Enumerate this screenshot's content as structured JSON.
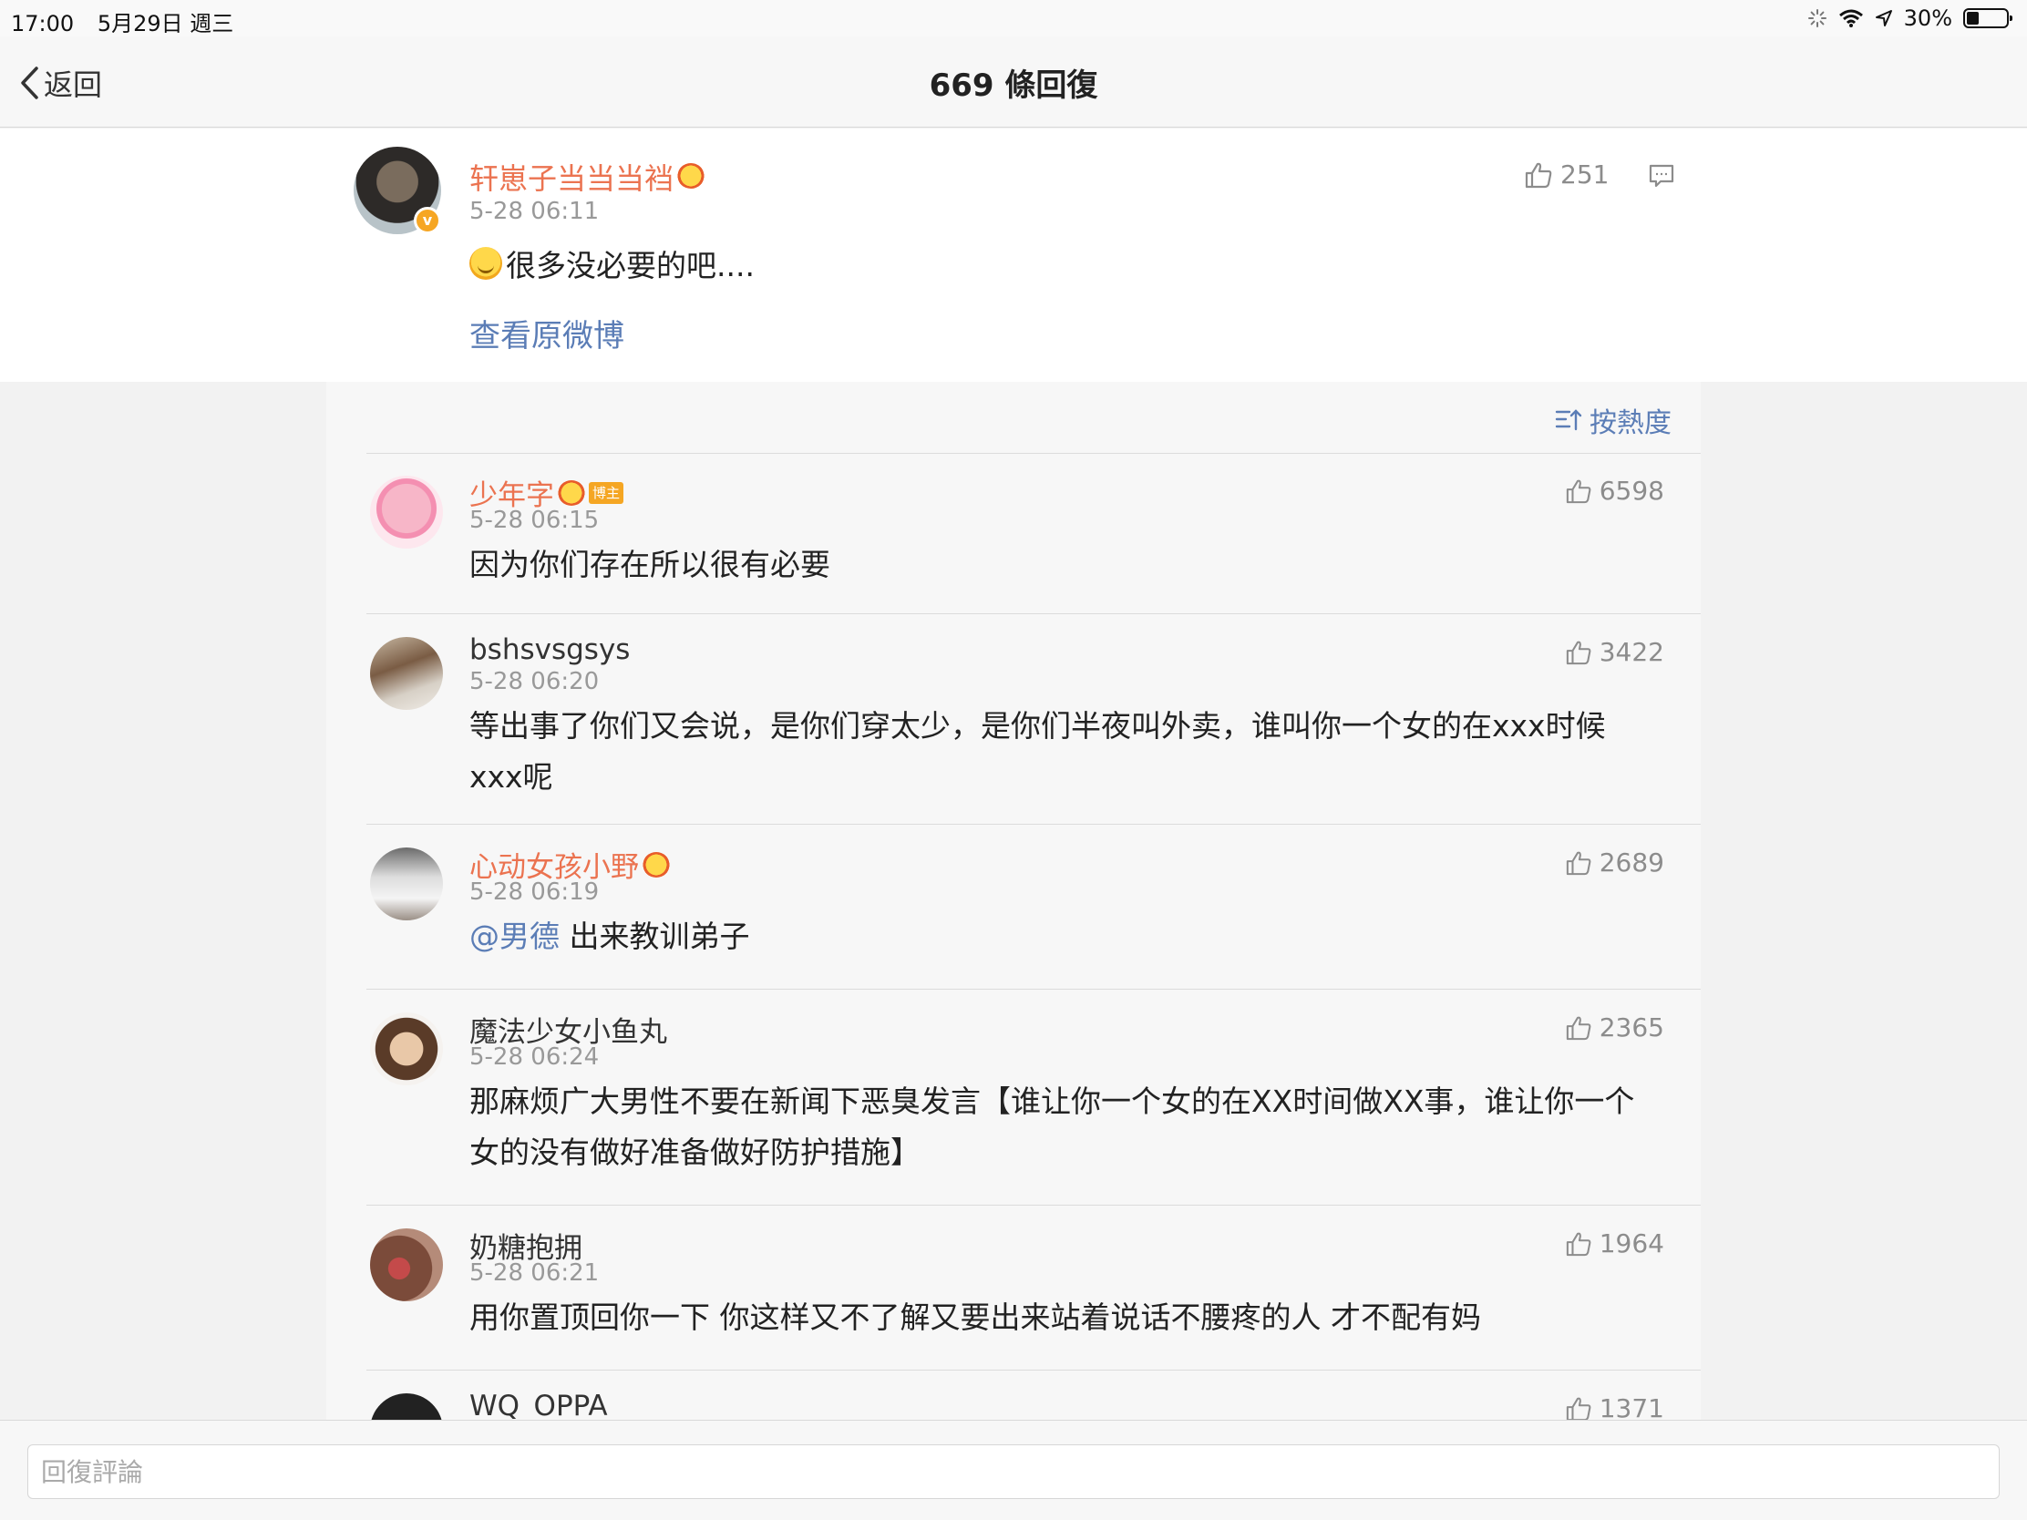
{
  "status_bar": {
    "time": "17:00",
    "date": "5月29日 週三",
    "battery": "30%",
    "battery_level": 0.3
  },
  "nav": {
    "back_label": "返回",
    "title": "669 條回復"
  },
  "original": {
    "author": "轩崽子当当当裆",
    "time": "5-28 06:11",
    "text": "很多没必要的吧....",
    "likes": "251",
    "view_original": "查看原微博",
    "verified_badge": "v"
  },
  "sort": {
    "label": "按熱度"
  },
  "replies": [
    {
      "name": "少年字",
      "tag": "博主",
      "time": "5-28 06:15",
      "text": "因为你们存在所以很有必要",
      "likes": "6598"
    },
    {
      "name": "bshsvsgsys",
      "time": "5-28 06:20",
      "text": "等出事了你们又会说，是你们穿太少，是你们半夜叫外卖，谁叫你一个女的在xxx时候xxx呢",
      "likes": "3422"
    },
    {
      "name": "心动女孩小野",
      "time": "5-28 06:19",
      "mention": "@男德",
      "text": " 出来教训弟子",
      "likes": "2689"
    },
    {
      "name": "魔法少女小鱼丸",
      "time": "5-28 06:24",
      "text": "那麻烦广大男性不要在新闻下恶臭发言【谁让你一个女的在XX时间做XX事，谁让你一个女的没有做好准备做好防护措施】",
      "likes": "2365"
    },
    {
      "name": "奶糖抱拥",
      "time": "5-28 06:21",
      "text": "用你置顶回你一下 你这样又不了解又要出来站着说话不腰疼的人 才不配有妈",
      "likes": "1964"
    },
    {
      "name": "WQ_OPPA",
      "likes": "1371"
    }
  ],
  "input": {
    "placeholder": "回復評論"
  }
}
